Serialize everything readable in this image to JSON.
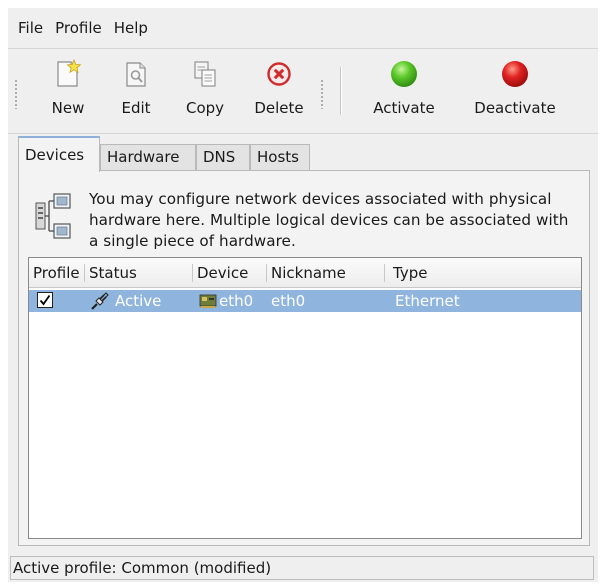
{
  "menubar": {
    "items": [
      "File",
      "Profile",
      "Help"
    ]
  },
  "toolbar": {
    "new_label": "New",
    "edit_label": "Edit",
    "copy_label": "Copy",
    "delete_label": "Delete",
    "activate_label": "Activate",
    "deactivate_label": "Deactivate"
  },
  "tabs": [
    "Devices",
    "Hardware",
    "DNS",
    "Hosts"
  ],
  "active_tab": "Devices",
  "info_text": "You may configure network devices associated with physical hardware here.  Multiple logical devices can be associated with a single piece of hardware.",
  "table": {
    "columns": [
      "Profile",
      "Status",
      "Device",
      "Nickname",
      "Type"
    ],
    "rows": [
      {
        "profile_checked": true,
        "status": "Active",
        "device": "eth0",
        "nickname": "eth0",
        "type": "Ethernet"
      }
    ]
  },
  "statusbar": {
    "text": "Active profile: Common (modified)"
  },
  "colors": {
    "selection": "#8fb4dd",
    "activate_green": "#3fae1e",
    "deactivate_red": "#d81818",
    "delete_red": "#d12a2a"
  },
  "icons": {
    "new": "new-file-icon",
    "edit": "edit-icon",
    "copy": "copy-icon",
    "delete": "delete-icon",
    "activate": "green-circle-icon",
    "deactivate": "red-circle-icon",
    "info": "network-devices-icon",
    "status": "plug-icon",
    "device": "ethernet-card-icon"
  }
}
